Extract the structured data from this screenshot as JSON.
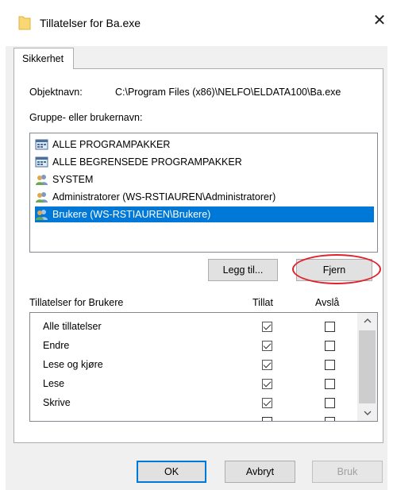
{
  "window": {
    "title": "Tillatelser for Ba.exe",
    "close_glyph": "✕"
  },
  "tabs": [
    {
      "label": "Sikkerhet"
    }
  ],
  "object": {
    "label": "Objektnavn:",
    "path": "C:\\Program Files (x86)\\NELFO\\ELDATA100\\Ba.exe"
  },
  "groups": {
    "label": "Gruppe- eller brukernavn:",
    "items": [
      {
        "name": "ALLE PROGRAMPAKKER",
        "icon": "package-icon",
        "selected": false
      },
      {
        "name": "ALLE BEGRENSEDE PROGRAMPAKKER",
        "icon": "package-icon",
        "selected": false
      },
      {
        "name": "SYSTEM",
        "icon": "users-icon",
        "selected": false
      },
      {
        "name": "Administratorer (WS-RSTIAUREN\\Administratorer)",
        "icon": "users-icon",
        "selected": false
      },
      {
        "name": "Brukere (WS-RSTIAUREN\\Brukere)",
        "icon": "users-icon",
        "selected": true
      }
    ]
  },
  "buttons": {
    "add": "Legg til...",
    "remove": "Fjern",
    "ok": "OK",
    "cancel": "Avbryt",
    "apply": "Bruk"
  },
  "permissions": {
    "label": "Tillatelser for Brukere",
    "allow_header": "Tillat",
    "deny_header": "Avslå",
    "rows": [
      {
        "name": "Alle tillatelser",
        "allow": true,
        "deny": false
      },
      {
        "name": "Endre",
        "allow": true,
        "deny": false
      },
      {
        "name": "Lese og kjøre",
        "allow": true,
        "deny": false
      },
      {
        "name": "Lese",
        "allow": true,
        "deny": false
      },
      {
        "name": "Skrive",
        "allow": true,
        "deny": false
      }
    ]
  },
  "colors": {
    "selection": "#0078d7",
    "highlight_ellipse": "#e0212b"
  }
}
